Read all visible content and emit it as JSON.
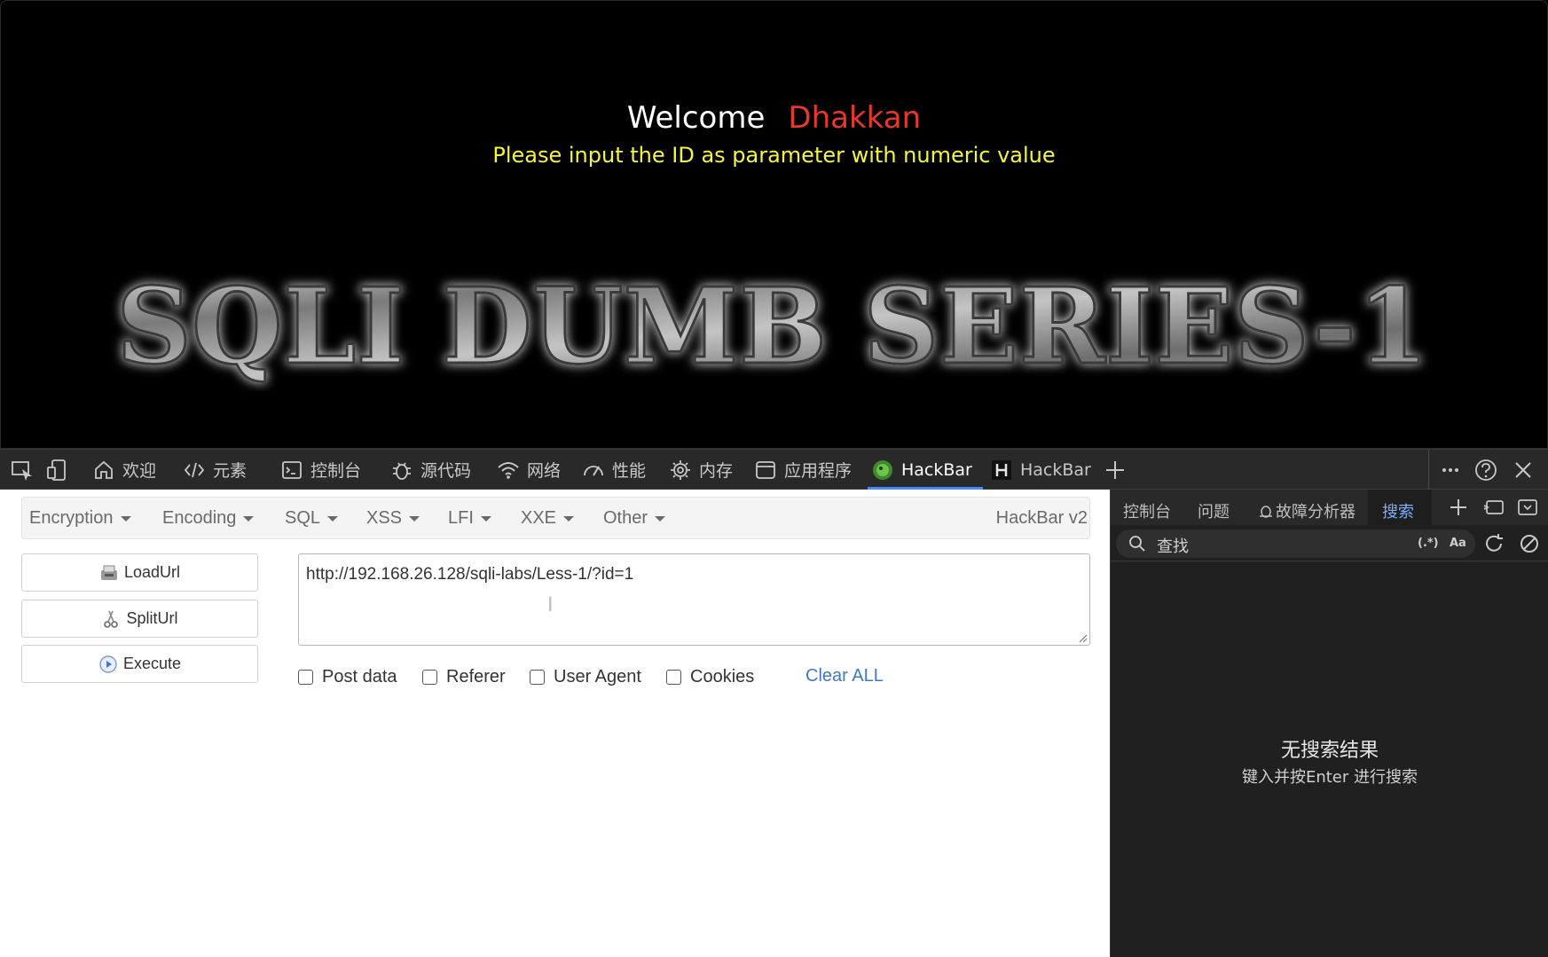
{
  "page": {
    "welcome": "Welcome",
    "user": "Dhakkan",
    "prompt": "Please input the ID as parameter with numeric value",
    "banner_text": "SQLI DUMB SERIES-1"
  },
  "devtools": {
    "tabs": [
      {
        "label": "欢迎",
        "icon": "home-icon"
      },
      {
        "label": "元素",
        "icon": "code-icon"
      },
      {
        "label": "控制台",
        "icon": "console-icon"
      },
      {
        "label": "源代码",
        "icon": "bug-icon"
      },
      {
        "label": "网络",
        "icon": "wifi-icon"
      },
      {
        "label": "性能",
        "icon": "gauge-icon"
      },
      {
        "label": "内存",
        "icon": "chip-icon"
      },
      {
        "label": "应用程序",
        "icon": "window-icon"
      },
      {
        "label": "HackBar",
        "icon": "hackbar-logo-icon",
        "active": true
      },
      {
        "label": "HackBar",
        "icon": "hackbar-h-icon"
      }
    ]
  },
  "hackbar": {
    "menu": [
      "Encryption",
      "Encoding",
      "SQL",
      "XSS",
      "LFI",
      "XXE",
      "Other"
    ],
    "brand": "HackBar v2",
    "buttons": {
      "load": "LoadUrl",
      "split": "SplitUrl",
      "execute": "Execute"
    },
    "url": "http://192.168.26.128/sqli-labs/Less-1/?id=1",
    "options": [
      "Post data",
      "Referer",
      "User Agent",
      "Cookies"
    ],
    "clear_all": "Clear ALL"
  },
  "drawer": {
    "tabs": [
      "控制台",
      "问题",
      "故障分析器",
      "搜索"
    ],
    "active_tab": "搜索",
    "search_placeholder": "查找",
    "regex_toggle": "(.*)",
    "case_toggle": "Aa",
    "no_result": "无搜索结果",
    "hint": "键入并按Enter 进行搜索"
  },
  "colors": {
    "welcome": "#ffffff",
    "user": "#e8382c",
    "prompt": "#f5f53a",
    "accent": "#4a8cf7",
    "link": "#3f78c4"
  }
}
